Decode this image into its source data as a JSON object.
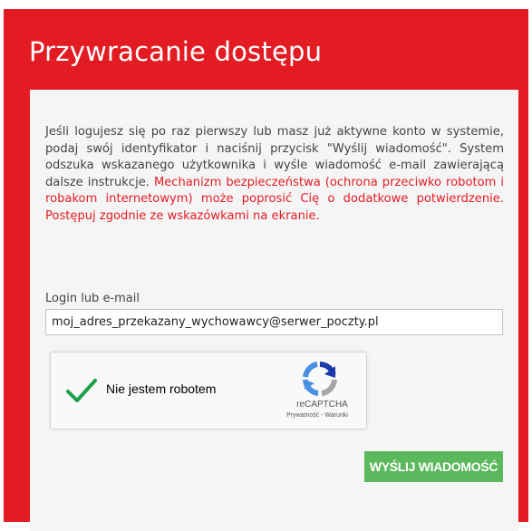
{
  "page": {
    "title": "Przywracanie dostępu"
  },
  "description": {
    "instructions": "Jeśli logujesz się po raz pierwszy lub masz już aktywne konto w systemie, podaj swój identyfikator i naciśnij przycisk \"Wyślij wiadomość\". System odszuka wskazanego użytkownika i wyśle wiadomość e-mail zawierającą dalsze instrukcje.",
    "security_notice": "Mechanizm bezpieczeństwa (ochrona przeciwko robotom i robakom internetowym) może poprosić Cię o dodatkowe potwierdzenie. Postępuj zgodnie ze wskazówkami na ekranie."
  },
  "form": {
    "login_label": "Login lub e-mail",
    "login_value": "moj_adres_przekazany_wychowawcy@serwer_poczty.pl"
  },
  "captcha": {
    "label": "Nie jestem robotem",
    "brand": "reCAPTCHA",
    "privacy_link": "Prywatność",
    "separator": " - ",
    "terms_link": "Warunki",
    "checked": true,
    "check_icon": "checkmark-icon",
    "logo_icon": "recaptcha-logo-icon"
  },
  "actions": {
    "send_label": "WYŚLIJ WIADOMOŚĆ"
  },
  "colors": {
    "brand_red": "#e31c23",
    "content_bg": "#f5f5f5",
    "button_green": "#5cb85c",
    "check_green": "#1e9e4b"
  }
}
